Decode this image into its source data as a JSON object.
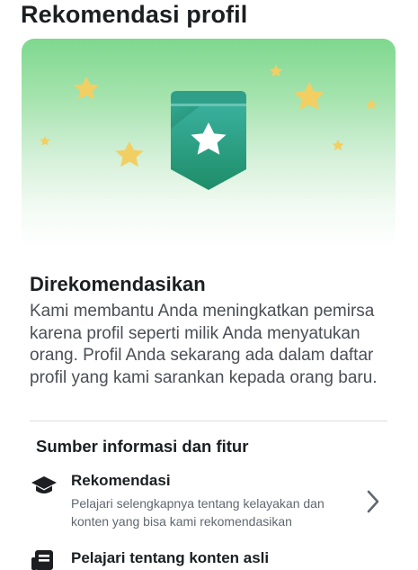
{
  "page": {
    "title": "Rekomendasi profil"
  },
  "hero": {
    "badge_icon": "star-badge-icon",
    "decoration": "stars"
  },
  "recommended": {
    "heading": "Direkomendasikan",
    "description": "Kami membantu Anda meningkatkan pemirsa karena profil seperti milik Anda menyatukan orang. Profil Anda sekarang ada dalam daftar profil yang kami sarankan kepada orang baru."
  },
  "sources": {
    "heading": "Sumber informasi dan fitur",
    "items": [
      {
        "title": "Rekomendasi",
        "subtitle": "Pelajari selengkapnya tentang kelayakan dan konten yang bisa kami rekomendasikan",
        "icon": "graduation-cap-icon",
        "action_icon": "chevron-right-icon"
      },
      {
        "title": "Pelajari tentang konten asli",
        "icon": "article-icon"
      }
    ]
  },
  "colors": {
    "hero_top": "#7ed88e",
    "badge_top": "#3ab3a2",
    "badge_bottom": "#1f8f6a",
    "star_yellow": "#f2cf63",
    "text_primary": "#1c1e21",
    "text_secondary": "#4b4f56"
  }
}
